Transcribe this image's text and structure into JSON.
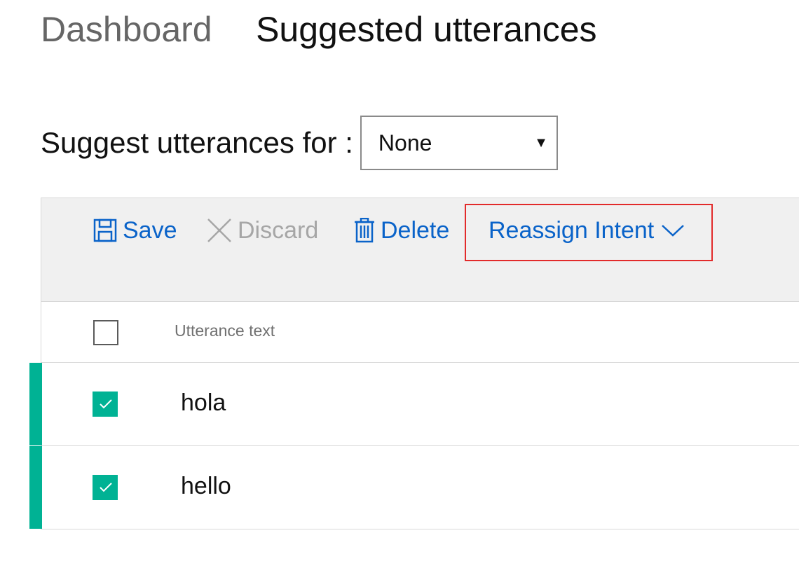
{
  "breadcrumb": {
    "parent": "Dashboard",
    "current": "Suggested utterances"
  },
  "filter": {
    "label": "Suggest utterances for :",
    "selected": "None"
  },
  "toolbar": {
    "save": "Save",
    "discard": "Discard",
    "delete": "Delete",
    "reassign": "Reassign Intent"
  },
  "grid": {
    "column_header": "Utterance text",
    "rows": [
      {
        "text": "hola",
        "checked": true
      },
      {
        "text": "hello",
        "checked": true
      }
    ]
  },
  "colors": {
    "link_blue": "#0a63c9",
    "accent_teal": "#00b294",
    "highlight_red": "#e22b2b",
    "toolbar_bg": "#f0f0f0"
  },
  "icons": {
    "save": "save-icon",
    "discard": "close-icon",
    "delete": "trash-icon",
    "reassign": "chevron-down-icon",
    "select": "caret-down-icon",
    "check": "checkmark-icon"
  }
}
